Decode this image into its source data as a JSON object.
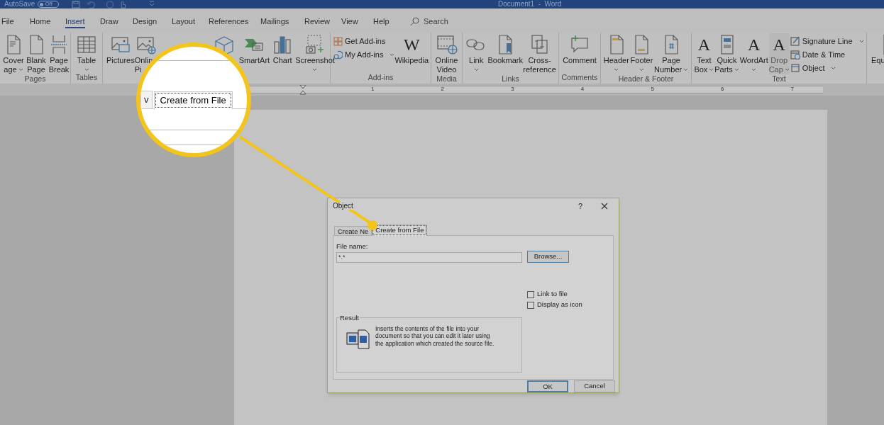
{
  "title_bar": {
    "autosave_label": "AutoSave",
    "autosave_toggle": {
      "label": "Off",
      "on": false
    },
    "document_title": "Document1  -  Word"
  },
  "ribbon_tabs": [
    {
      "label": "File",
      "selected": false
    },
    {
      "label": "Home",
      "selected": false
    },
    {
      "label": "Insert",
      "selected": true
    },
    {
      "label": "Draw",
      "selected": false
    },
    {
      "label": "Design",
      "selected": false
    },
    {
      "label": "Layout",
      "selected": false
    },
    {
      "label": "References",
      "selected": false
    },
    {
      "label": "Mailings",
      "selected": false
    },
    {
      "label": "Review",
      "selected": false
    },
    {
      "label": "View",
      "selected": false
    },
    {
      "label": "Help",
      "selected": false
    }
  ],
  "search": {
    "placeholder": "Search"
  },
  "ribbon_groups": [
    {
      "label": "Pages",
      "commands": [
        {
          "kind": "large",
          "lines": [
            "Cover",
            "age"
          ],
          "dropdown": true,
          "disabled": false
        },
        {
          "kind": "large",
          "lines": [
            "Blank",
            "Page"
          ],
          "dropdown": false,
          "disabled": false
        },
        {
          "kind": "large",
          "lines": [
            "Page",
            "Break"
          ],
          "dropdown": false,
          "disabled": false
        }
      ]
    },
    {
      "label": "Tables",
      "commands": [
        {
          "kind": "large",
          "lines": [
            "Table"
          ],
          "dropdown": true,
          "disabled": false
        }
      ]
    },
    {
      "commands": [
        {
          "kind": "large",
          "lines": [
            "Pictures"
          ],
          "dropdown": false,
          "disabled": false
        },
        {
          "kind": "large",
          "lines": [
            "Onlin",
            "Pi"
          ],
          "disabled": false
        },
        {
          "kind": "icon_only"
        },
        {
          "kind": "large",
          "lines": [
            "SmartArt"
          ],
          "dropdown": false,
          "disabled": false
        },
        {
          "kind": "large",
          "lines": [
            "Chart"
          ],
          "dropdown": false,
          "disabled": false
        },
        {
          "kind": "large",
          "lines": [
            "Screenshot"
          ],
          "dropdown": true,
          "disabled": false
        }
      ]
    },
    {
      "label": "Add-ins",
      "commands": [
        {
          "kind": "small",
          "lines": [
            "Get Add-ins"
          ],
          "dropdown": false,
          "disabled": false
        },
        {
          "kind": "small",
          "lines": [
            "My Add-ins"
          ],
          "dropdown": true,
          "disabled": false
        },
        {
          "kind": "large",
          "lines": [
            "Wikipedia"
          ],
          "icon_text": "W",
          "dropdown": false,
          "disabled": false
        }
      ]
    },
    {
      "label": "Media",
      "commands": [
        {
          "kind": "large",
          "lines": [
            "Online",
            "Video"
          ],
          "dropdown": false,
          "disabled": false
        }
      ]
    },
    {
      "label": "Links",
      "commands": [
        {
          "kind": "large",
          "lines": [
            "Link"
          ],
          "dropdown": true,
          "disabled": false
        },
        {
          "kind": "large",
          "lines": [
            "Bookmark"
          ],
          "dropdown": false,
          "disabled": false
        },
        {
          "kind": "large",
          "lines": [
            "Cross-",
            "reference"
          ],
          "dropdown": false,
          "disabled": false
        }
      ]
    },
    {
      "label": "Comments",
      "commands": [
        {
          "kind": "large",
          "lines": [
            "Comment"
          ],
          "dropdown": false,
          "disabled": false
        }
      ]
    },
    {
      "label": "Header & Footer",
      "commands": [
        {
          "kind": "large",
          "lines": [
            "Header"
          ],
          "dropdown": true,
          "disabled": false
        },
        {
          "kind": "large",
          "lines": [
            "Footer"
          ],
          "dropdown": true,
          "disabled": false
        },
        {
          "kind": "large",
          "lines": [
            "Page",
            "Number"
          ],
          "dropdown": true,
          "disabled": false
        }
      ]
    },
    {
      "label": "Text",
      "commands": [
        {
          "kind": "large",
          "lines": [
            "Text",
            "Box"
          ],
          "icon_text": "A",
          "dropdown": true,
          "disabled": false
        },
        {
          "kind": "large",
          "lines": [
            "Quick",
            "Parts"
          ],
          "dropdown": true,
          "disabled": false
        },
        {
          "kind": "large",
          "lines": [
            "WordArt"
          ],
          "icon_text": "A",
          "dropdown": true,
          "disabled": false
        },
        {
          "kind": "large",
          "lines": [
            "Drop",
            "Cap"
          ],
          "icon_text": "A",
          "dropdown": true,
          "disabled": true
        },
        {
          "kind": "small",
          "lines": [
            "Signature Line"
          ],
          "dropdown": true,
          "disabled": false
        },
        {
          "kind": "small",
          "lines": [
            "Date & Time"
          ],
          "dropdown": false,
          "disabled": false
        },
        {
          "kind": "small",
          "lines": [
            "Object"
          ],
          "dropdown": true,
          "disabled": false
        }
      ]
    },
    {
      "commands": [
        {
          "kind": "large",
          "lines": [
            "Equ"
          ],
          "dropdown": false,
          "disabled": false
        }
      ]
    }
  ],
  "ruler": {
    "marks": [
      "1",
      "2",
      "3",
      "4",
      "5",
      "6",
      "7"
    ]
  },
  "dialog": {
    "title": "Object",
    "help": "?",
    "tabs": [
      {
        "label": "Create Ne",
        "selected": false
      },
      {
        "label": "Create from File",
        "selected": true
      }
    ],
    "file_name_label": "File name:",
    "file_name_value": "*.*",
    "browse_button": "Browse...",
    "checkboxes": [
      {
        "label": "Link to file",
        "checked": false
      },
      {
        "label": "Display as icon",
        "checked": false
      }
    ],
    "result_label": "Result",
    "result_text": "Inserts the contents of the file into your document so that you can edit it later using the application which created the source file.",
    "buttons": [
      {
        "label": "OK",
        "default": true
      },
      {
        "label": "Cancel",
        "default": false
      }
    ]
  },
  "magnifier": {
    "tabs": [
      {
        "label": "v",
        "selected": false
      },
      {
        "label": "Create from File",
        "selected": true
      }
    ]
  }
}
